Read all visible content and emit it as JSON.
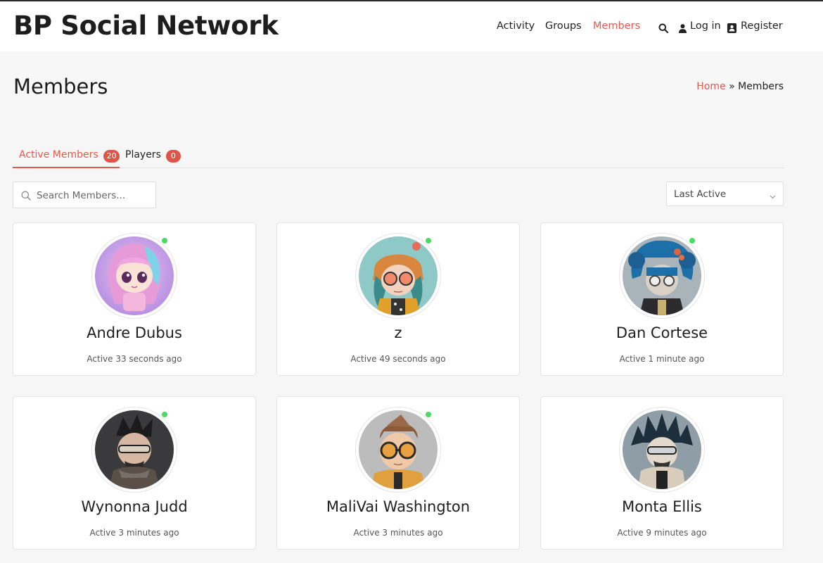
{
  "site": {
    "title": "BP Social Network"
  },
  "nav": {
    "items": [
      {
        "label": "Activity",
        "active": false
      },
      {
        "label": "Groups",
        "active": false
      },
      {
        "label": "Members",
        "active": true
      }
    ],
    "login_label": "Log in",
    "register_label": "Register",
    "icons": [
      "search-icon",
      "user-icon",
      "contact-card-icon"
    ]
  },
  "page": {
    "title": "Members",
    "breadcrumb": {
      "home": "Home",
      "separator": "»",
      "current": "Members"
    }
  },
  "tabs": [
    {
      "label": "Active Members",
      "count": "20",
      "active": true
    },
    {
      "label": "Players",
      "count": "0",
      "active": false
    }
  ],
  "search": {
    "placeholder": "Search Members..."
  },
  "sort": {
    "selected": "Last Active"
  },
  "members": [
    {
      "name": "Andre Dubus",
      "active_text": "Active 33 seconds ago",
      "online": true
    },
    {
      "name": "z",
      "active_text": "Active 49 seconds ago",
      "online": true
    },
    {
      "name": "Dan Cortese",
      "active_text": "Active 1 minute ago",
      "online": true
    },
    {
      "name": "Wynonna Judd",
      "active_text": "Active 3 minutes ago",
      "online": true
    },
    {
      "name": "MaliVai Washington",
      "active_text": "Active 3 minutes ago",
      "online": true
    },
    {
      "name": "Monta Ellis",
      "active_text": "Active 9 minutes ago",
      "online": false
    }
  ],
  "colors": {
    "accent": "#e05a4f",
    "badge": "#dc5548",
    "online": "#4cd964"
  }
}
